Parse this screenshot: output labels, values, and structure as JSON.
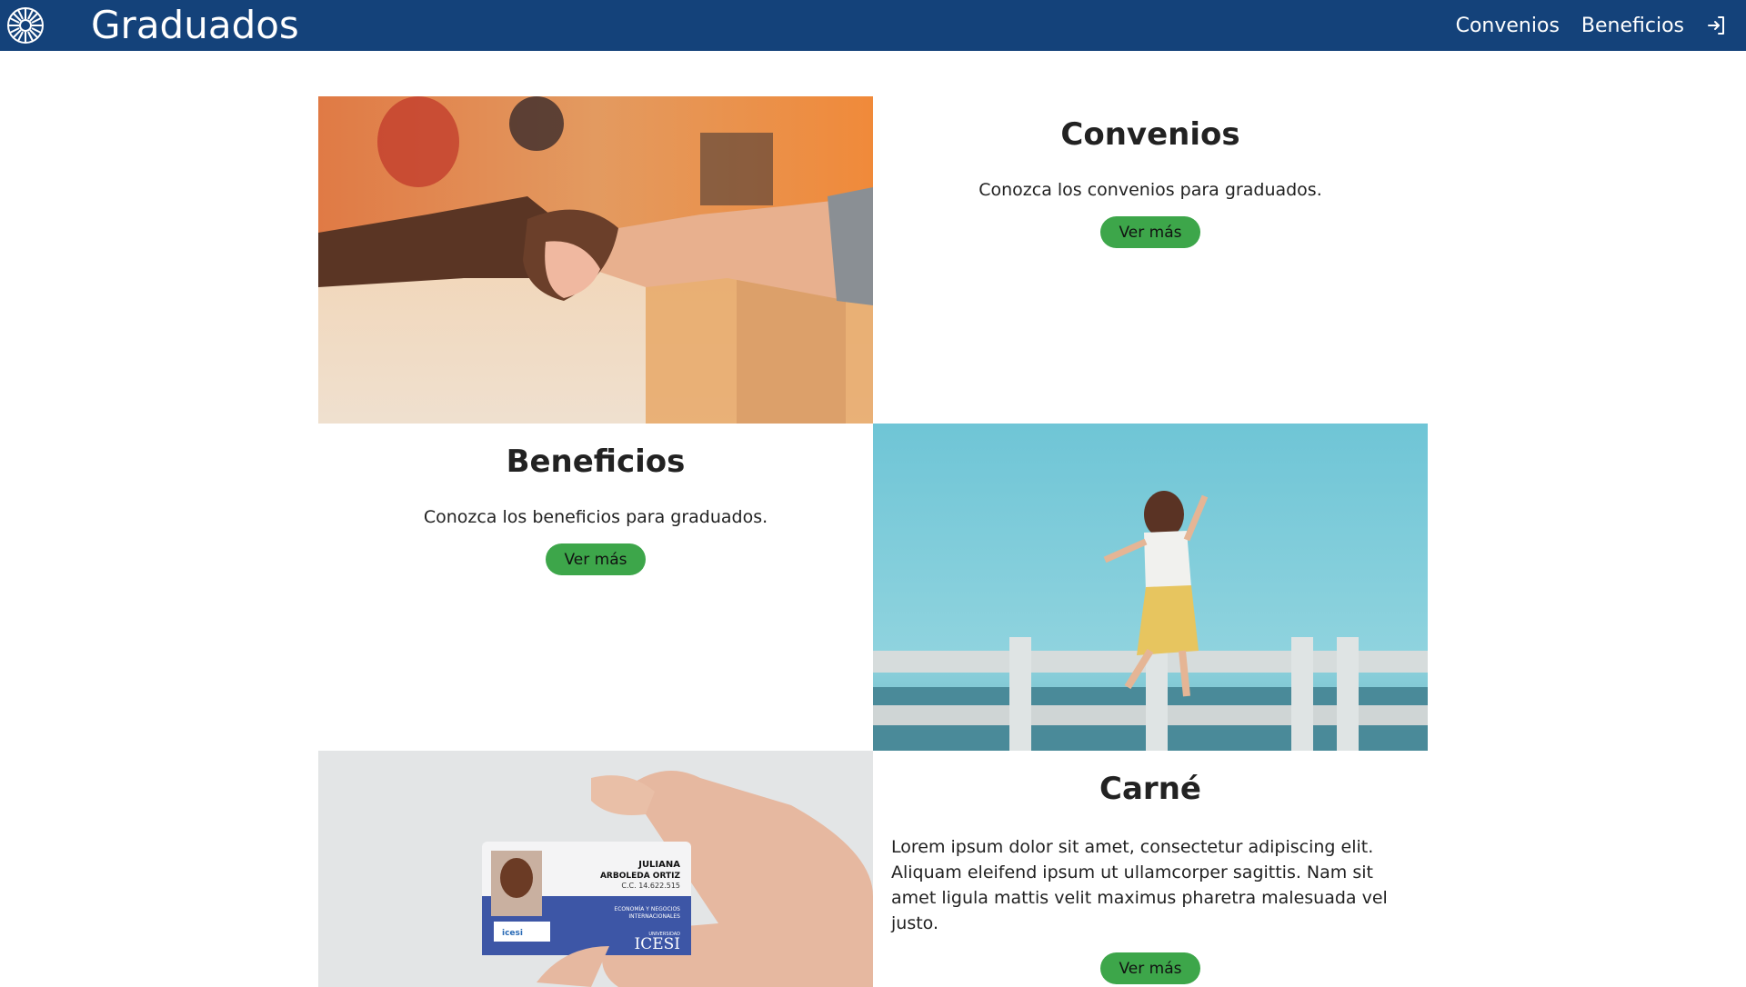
{
  "header": {
    "title": "Graduados",
    "nav": [
      "Convenios",
      "Beneficios"
    ],
    "logo_icon": "university-seal-icon",
    "login_icon": "sign-in-icon"
  },
  "colors": {
    "navbar": "#14427a",
    "button": "#3da64a"
  },
  "sections": [
    {
      "title": "Convenios",
      "description": "Conozca los convenios para graduados.",
      "button": "Ver más",
      "image": "handshake-photo"
    },
    {
      "title": "Beneficios",
      "description": "Conozca los beneficios para graduados.",
      "button": "Ver más",
      "image": "woman-jumping-photo"
    },
    {
      "title": "Carné",
      "description": "Lorem ipsum dolor sit amet, consectetur adipiscing elit. Aliquam eleifend ipsum ut ullamcorper sagittis. Nam sit amet ligula mattis velit maximus pharetra malesuada vel justo.",
      "button": "Ver más",
      "image": "id-card-photo",
      "card": {
        "first_name": "JULIANA",
        "last_name": "ARBOLEDA ORTIZ",
        "id_number": "C.C. 14.622.515",
        "program_line1": "ECONOMÍA Y NEGOCIOS",
        "program_line2": "INTERNACIONALES",
        "university_label": "UNIVERSIDAD",
        "university_name": "ICESI",
        "sticker_text": "icesi"
      }
    }
  ]
}
